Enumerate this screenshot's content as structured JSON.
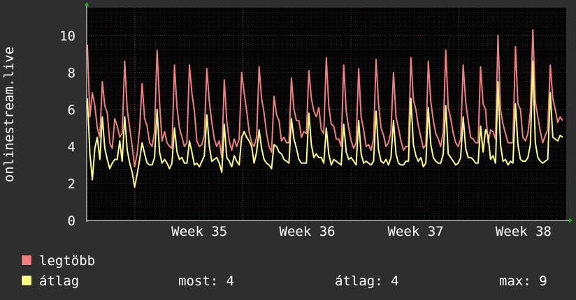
{
  "chart_data": {
    "type": "line",
    "ylabel": "onlinestream.live",
    "ylim": [
      0,
      11.5
    ],
    "yticks": [
      0,
      2,
      4,
      6,
      8,
      10
    ],
    "xlim": [
      0,
      1
    ],
    "xticks": [
      {
        "label": "Week 35",
        "pos": 0.235
      },
      {
        "label": "Week 36",
        "pos": 0.46
      },
      {
        "label": "Week 37",
        "pos": 0.686
      },
      {
        "label": "Week 38",
        "pos": 0.911
      }
    ],
    "grid": true,
    "legend_position": "bottom-left",
    "series": [
      {
        "name": "legtöbb",
        "color": "#f07f7f",
        "values": [
          9.5,
          5.6,
          6.9,
          6.2,
          5.0,
          4.5,
          7.5,
          6.2,
          5.8,
          4.2,
          3.9,
          5.5,
          5.1,
          4.5,
          4.7,
          8.6,
          6.0,
          5.0,
          4.0,
          2.9,
          3.6,
          5.0,
          7.4,
          5.5,
          5.1,
          4.2,
          4.0,
          4.8,
          9.2,
          6.4,
          4.3,
          4.8,
          4.2,
          4.0,
          3.9,
          8.4,
          6.1,
          5.0,
          4.5,
          4.0,
          4.2,
          8.4,
          6.9,
          5.9,
          4.3,
          4.0,
          4.1,
          4.6,
          8.2,
          6.4,
          5.3,
          4.4,
          4.0,
          4.3,
          3.4,
          7.6,
          5.4,
          4.3,
          3.8,
          4.4,
          4.0,
          4.4,
          8.0,
          6.9,
          5.9,
          4.8,
          4.2,
          4.0,
          4.5,
          8.3,
          6.6,
          5.8,
          4.7,
          4.0,
          3.7,
          6.7,
          5.7,
          5.4,
          4.3,
          4.5,
          4.2,
          4.2,
          7.7,
          6.0,
          5.4,
          5.4,
          4.5,
          4.8,
          4.7,
          8.1,
          6.6,
          5.9,
          5.6,
          6.1,
          4.9,
          4.7,
          8.8,
          6.2,
          5.2,
          5.1,
          4.4,
          4.4,
          4.0,
          8.4,
          5.9,
          5.0,
          4.3,
          3.9,
          4.2,
          8.2,
          5.6,
          4.9,
          4.0,
          4.1,
          3.8,
          4.4,
          8.7,
          6.3,
          5.0,
          4.6,
          4.0,
          4.2,
          4.8,
          8.0,
          5.6,
          5.0,
          4.3,
          3.8,
          4.0,
          4.0,
          8.8,
          6.5,
          6.0,
          5.1,
          4.5,
          3.9,
          4.1,
          8.6,
          6.4,
          5.4,
          4.7,
          4.4,
          4.0,
          4.8,
          9.2,
          6.1,
          5.5,
          4.7,
          4.2,
          4.0,
          4.4,
          8.4,
          6.4,
          5.4,
          4.5,
          4.4,
          4.2,
          4.2,
          8.3,
          6.3,
          6.0,
          4.2,
          4.9,
          4.8,
          4.4,
          10.0,
          6.0,
          5.2,
          4.7,
          4.2,
          4.2,
          4.2,
          9.4,
          6.3,
          6.0,
          4.5,
          4.3,
          4.7,
          5.9,
          10.3,
          6.4,
          5.6,
          4.8,
          4.2,
          4.6,
          4.9,
          8.4,
          6.6,
          6.0,
          5.3,
          5.6,
          5.4
        ]
      },
      {
        "name": "átlag",
        "color": "#ffff7f",
        "values": [
          6.6,
          3.6,
          2.2,
          3.9,
          4.5,
          3.3,
          5.6,
          3.9,
          3.3,
          2.8,
          3.1,
          3.3,
          3.3,
          4.3,
          3.2,
          5.6,
          3.8,
          3.1,
          2.6,
          1.8,
          2.5,
          3.3,
          4.2,
          3.6,
          3.1,
          3.0,
          3.0,
          3.4,
          6.0,
          3.7,
          3.1,
          3.3,
          3.1,
          2.8,
          3.1,
          5.0,
          3.7,
          3.3,
          3.4,
          3.1,
          3.1,
          4.3,
          3.7,
          3.0,
          3.1,
          2.9,
          3.2,
          3.5,
          5.7,
          4.0,
          3.2,
          3.3,
          3.4,
          3.1,
          2.6,
          5.2,
          3.4,
          3.2,
          2.9,
          3.5,
          3.2,
          3.0,
          4.5,
          4.8,
          4.5,
          4.3,
          4.0,
          3.1,
          3.7,
          4.9,
          3.9,
          3.3,
          3.1,
          3.0,
          2.8,
          4.1,
          4.0,
          3.7,
          3.6,
          3.3,
          3.2,
          3.1,
          5.5,
          4.4,
          3.9,
          3.3,
          3.1,
          3.1,
          3.1,
          5.8,
          4.1,
          3.4,
          3.6,
          3.4,
          3.4,
          3.1,
          5.0,
          3.6,
          3.0,
          3.3,
          3.2,
          3.1,
          3.0,
          5.2,
          3.7,
          3.3,
          3.4,
          3.2,
          3.0,
          5.4,
          3.6,
          3.1,
          3.2,
          3.1,
          3.0,
          3.2,
          5.9,
          3.8,
          3.2,
          3.1,
          3.3,
          3.0,
          3.4,
          5.4,
          3.6,
          3.1,
          3.0,
          3.0,
          3.2,
          3.2,
          6.6,
          4.1,
          3.5,
          3.2,
          3.4,
          2.9,
          3.1,
          6.1,
          4.1,
          3.4,
          3.2,
          3.1,
          3.1,
          3.6,
          6.2,
          3.6,
          3.4,
          3.2,
          3.0,
          3.1,
          3.4,
          5.6,
          3.9,
          3.4,
          3.4,
          3.3,
          3.1,
          3.1,
          5.1,
          3.7,
          4.9,
          4.6,
          3.3,
          3.5,
          3.1,
          7.5,
          4.1,
          3.2,
          3.3,
          3.0,
          3.2,
          3.1,
          6.3,
          4.1,
          3.3,
          3.2,
          3.2,
          3.4,
          4.1,
          8.6,
          4.2,
          3.4,
          3.2,
          3.1,
          3.2,
          3.3,
          6.9,
          4.5,
          4.4,
          4.3,
          4.6,
          4.5
        ]
      }
    ]
  },
  "legend": [
    {
      "label": "legtöbb",
      "color": "#f07f7f"
    },
    {
      "label": "átlag",
      "color": "#ffff7f"
    }
  ],
  "stats": {
    "most": "most: 4",
    "atlag": "átlag: 4",
    "max": "max: 9"
  }
}
